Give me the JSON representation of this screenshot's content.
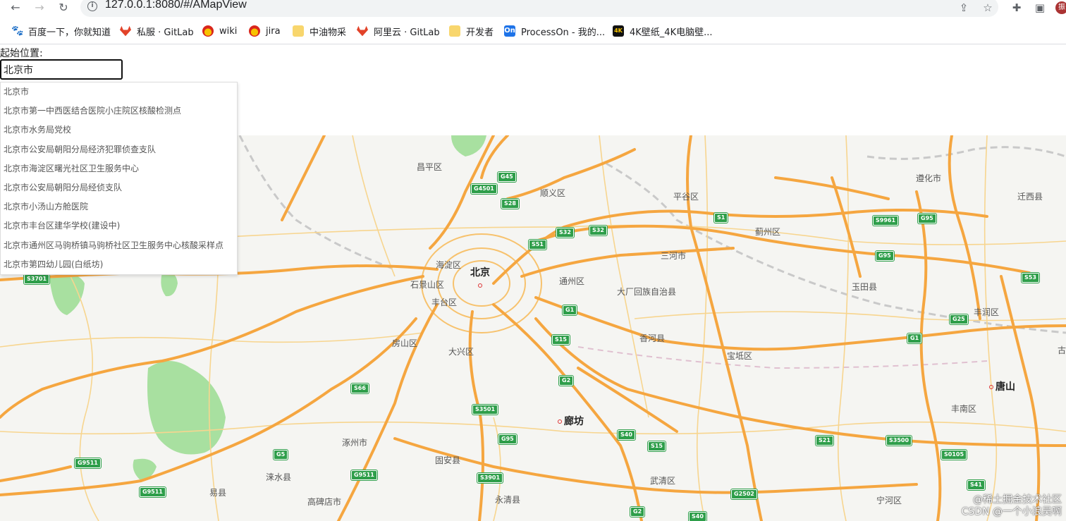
{
  "browser": {
    "url": "127.0.0.1:8080/#/AMapView",
    "avatar_text": "振"
  },
  "bookmarks": [
    {
      "label": "百度一下，你就知道",
      "icon": "baidu-paw-icon",
      "color": "#2932e1"
    },
    {
      "label": "私服 · GitLab",
      "icon": "gitlab-icon",
      "color": "#e24329"
    },
    {
      "label": "wiki",
      "icon": "petrochina-icon",
      "color": "#d9261c"
    },
    {
      "label": "jira",
      "icon": "petrochina-icon",
      "color": "#d9261c"
    },
    {
      "label": "中油物采",
      "icon": "folder-icon",
      "color": "#f8d66d"
    },
    {
      "label": "阿里云 · GitLab",
      "icon": "gitlab-icon",
      "color": "#e24329"
    },
    {
      "label": "开发者",
      "icon": "folder-icon",
      "color": "#f8d66d"
    },
    {
      "label": "ProcessOn - 我的...",
      "icon": "processon-icon",
      "color": "#1e73e8"
    },
    {
      "label": "4K壁纸_4K电脑壁...",
      "icon": "4k-icon",
      "color": "#111111"
    }
  ],
  "form": {
    "start_label": "起始位置:",
    "search_value": "北京市"
  },
  "suggestions": [
    "北京市",
    "北京市第一中西医结合医院小庄院区核酸检测点",
    "北京市水务局党校",
    "北京市公安局朝阳分局经济犯罪侦查支队",
    "北京市海淀区曙光社区卫生服务中心",
    "北京市公安局朝阳分局经侦支队",
    "北京市小汤山方舱医院",
    "北京市丰台区建华学校(建设中)",
    "北京市通州区马驹桥镇马驹桥社区卫生服务中心核酸采样点",
    "北京市第四幼儿园(白纸坊)"
  ],
  "map": {
    "labels": {
      "beijing": "北京",
      "changping": "昌平区",
      "shunyi": "顺义区",
      "pinggu": "平谷区",
      "zunhua": "遵化市",
      "qianxi": "迁西县",
      "jizhou": "蓟州区",
      "sanhe": "三河市",
      "haidian": "海淀区",
      "shijingshan": "石景山区",
      "fengtai": "丰台区",
      "tongzhou": "通州区",
      "dachang": "大厂回族自治县",
      "yutian": "玉田县",
      "fengrun": "丰润区",
      "fangshan": "房山区",
      "daxing": "大兴区",
      "xianghe": "香河县",
      "baodi": "宝坻区",
      "tangshan": "唐山",
      "fengnan": "丰南区",
      "langfang": "廊坊",
      "zhuozhou": "涿州市",
      "gu_an": "固安县",
      "laishui": "涞水县",
      "yixian": "易县",
      "gaobeidian": "高碑店市",
      "yongqing": "永清县",
      "wuqing": "武清区",
      "ninghe": "宁河区",
      "gu": "古"
    },
    "shields": [
      "G45",
      "G4501",
      "S28",
      "S32",
      "S32",
      "S51",
      "S1",
      "S9961",
      "G95",
      "G95",
      "S3701",
      "G1",
      "S53",
      "G25",
      "S15",
      "G1",
      "G2",
      "S66",
      "S3501",
      "G95",
      "S40",
      "S15",
      "S21",
      "S3500",
      "S0105",
      "G5",
      "G9511",
      "G9511",
      "G9511",
      "S3901",
      "G2502",
      "S41",
      "G2",
      "S40"
    ],
    "watermark_line1": "@稀土掘金技术社区",
    "watermark_line2": "CSDN @一个小浪吴啊",
    "colors": {
      "highway": "#f5a640",
      "road": "#f7d58f",
      "green": "#a8e0a0",
      "rail": "#c9c9c9",
      "background": "#f5f5f2"
    }
  }
}
